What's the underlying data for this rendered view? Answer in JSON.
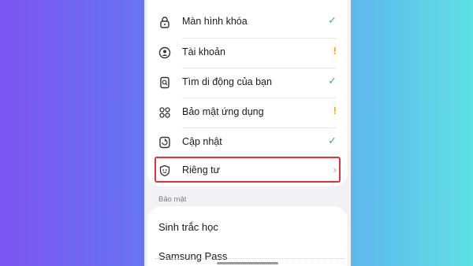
{
  "settings": {
    "items": [
      {
        "label": "Màn hình khóa",
        "icon": "lock-icon",
        "status": "✓",
        "status_type": "ok"
      },
      {
        "label": "Tài khoản",
        "icon": "account-icon",
        "status": "!",
        "status_type": "warn"
      },
      {
        "label": "Tìm di động của bạn",
        "icon": "find-phone-icon",
        "status": "✓",
        "status_type": "ok"
      },
      {
        "label": "Bảo mật ứng dụng",
        "icon": "app-security-icon",
        "status": "!",
        "status_type": "warn"
      },
      {
        "label": "Cập nhật",
        "icon": "update-icon",
        "status": "✓",
        "status_type": "ok"
      },
      {
        "label": "Riêng tư",
        "icon": "privacy-icon",
        "status": "›",
        "status_type": "chevron"
      }
    ],
    "section_title": "Bảo mật",
    "security_items": [
      {
        "label": "Sinh trắc học"
      },
      {
        "label": "Samsung Pass"
      }
    ]
  },
  "colors": {
    "ok": "#3bb56b",
    "warn": "#f4a419",
    "highlight": "#d9363e",
    "background_left": "#7b55f0",
    "background_right": "#5fe0e4"
  }
}
